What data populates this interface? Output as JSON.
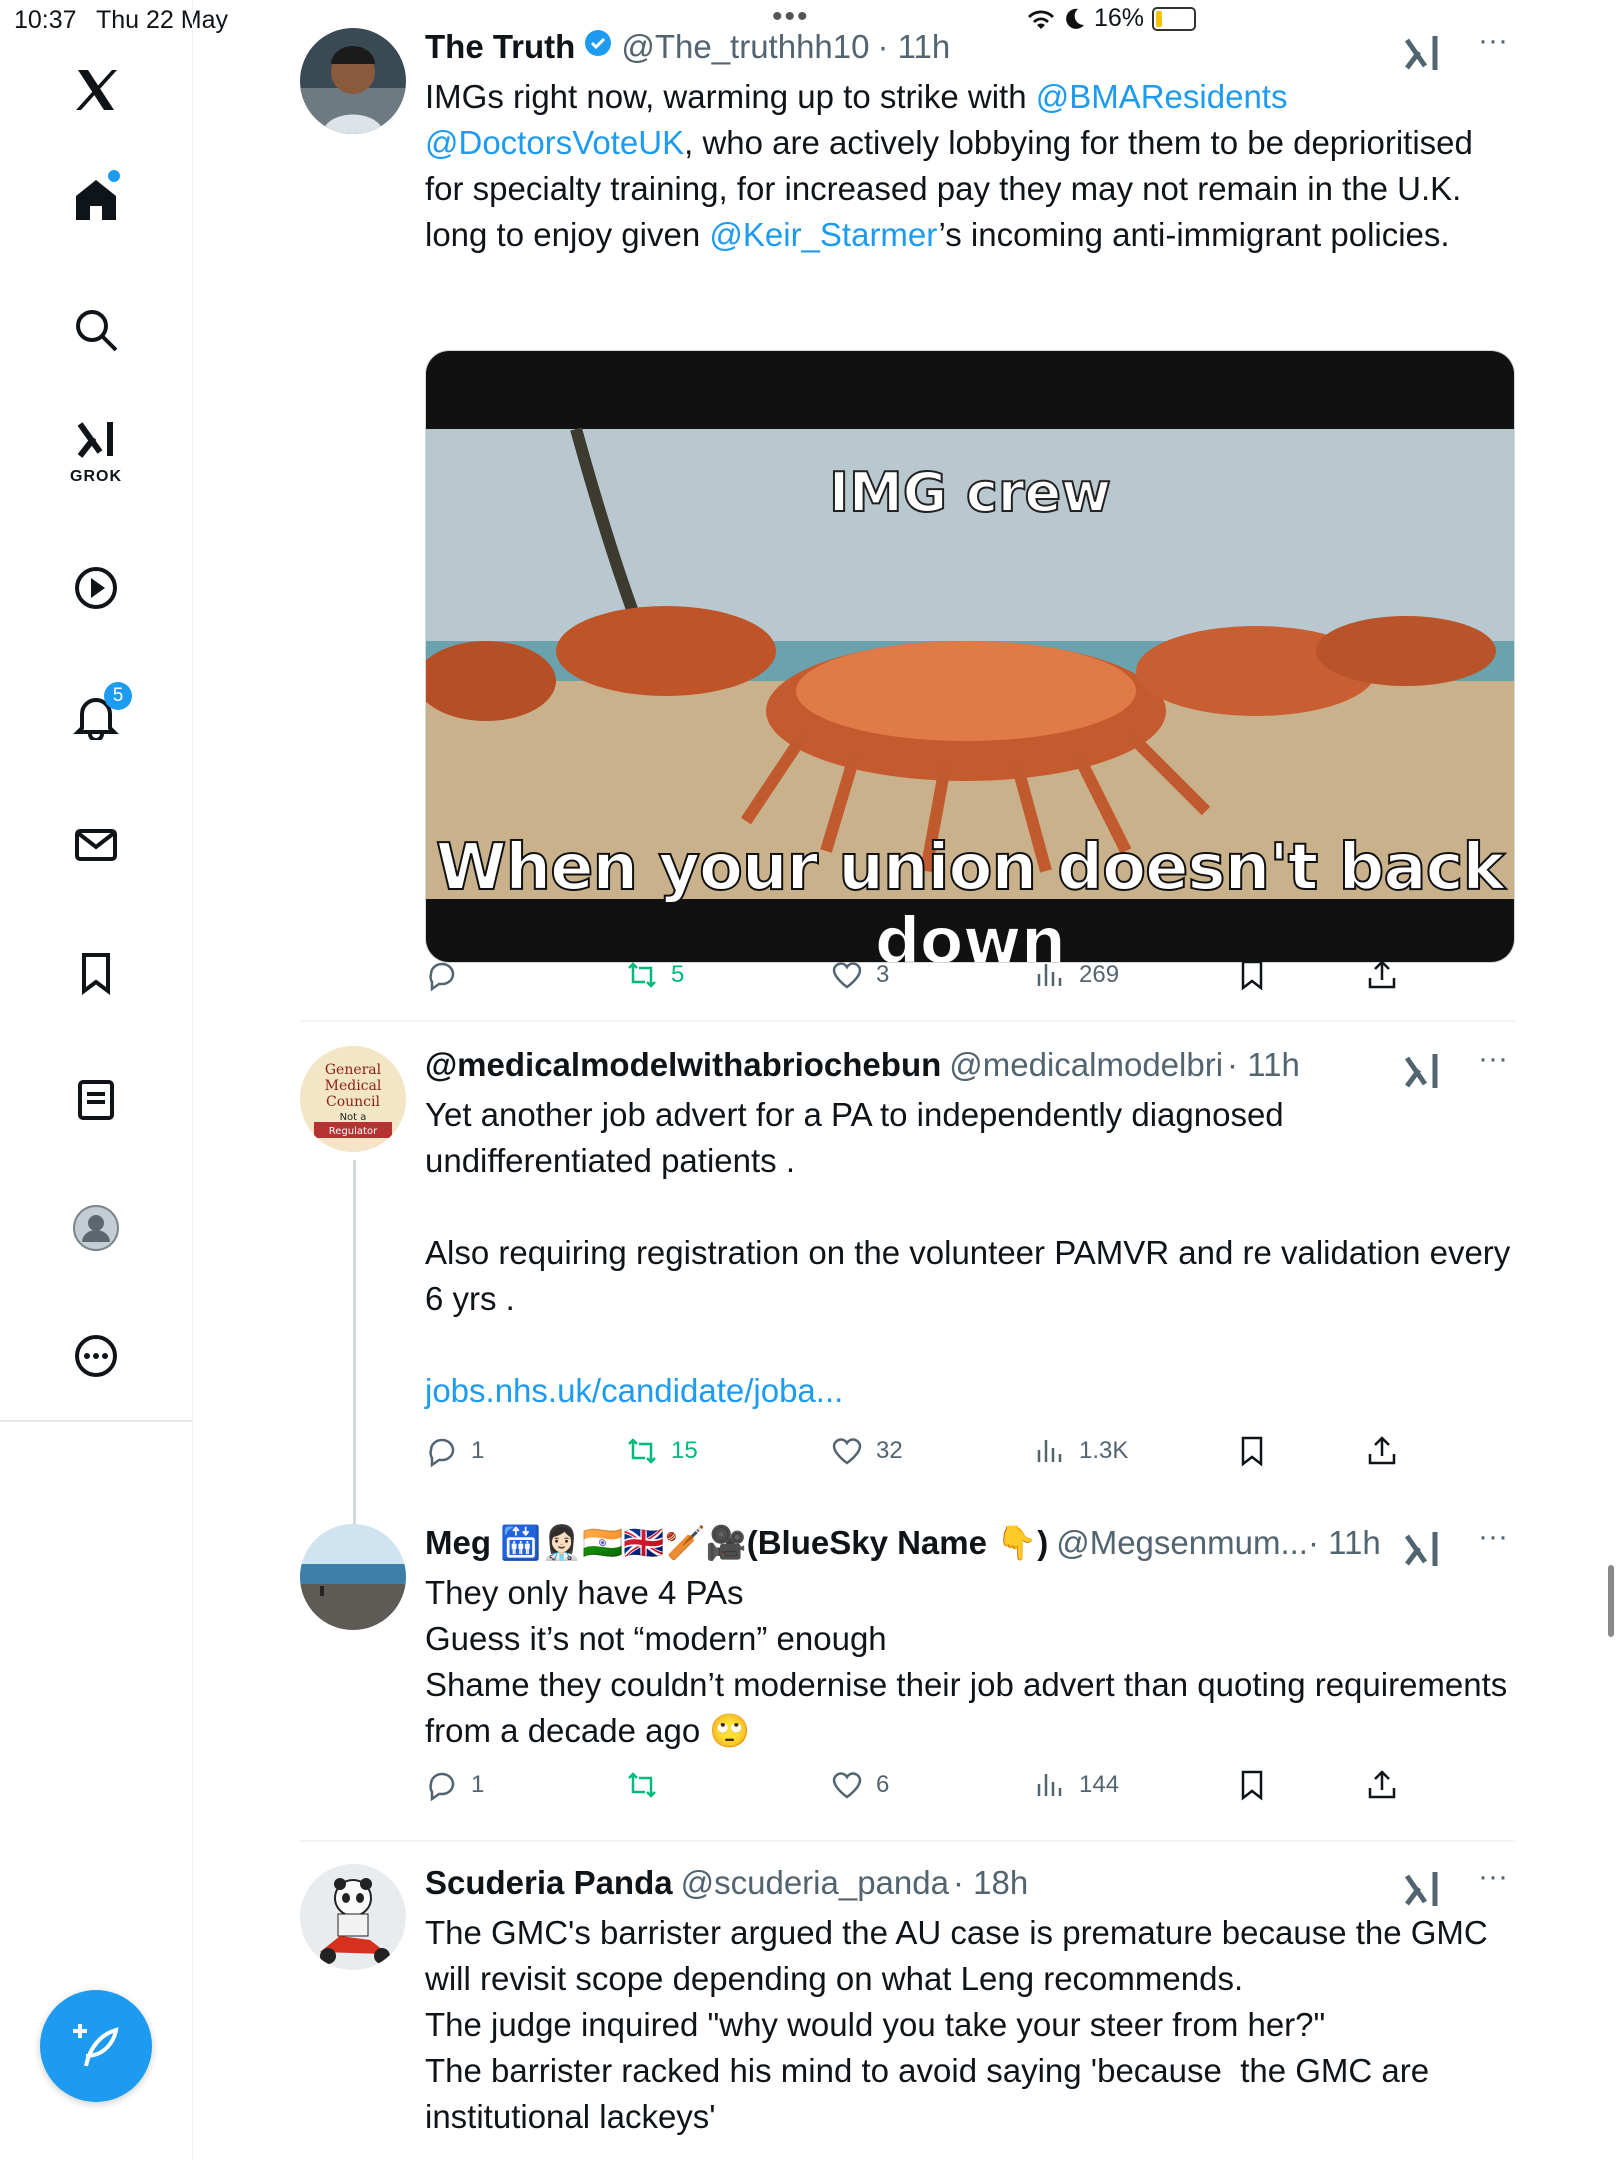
{
  "status_bar": {
    "time": "10:37",
    "date": "Thu 22 May",
    "battery": "16%",
    "battery_level": 0.16
  },
  "sidebar": {
    "notifications_badge": "5",
    "grok_label": "GROK"
  },
  "tweets": [
    {
      "name": "The Truth",
      "handle": "@The_truthhh10",
      "time": "· 11h",
      "text_parts": [
        "IMGs right now, warming up to strike with ",
        "@BMAResidents",
        " ",
        "@DoctorsVoteUK",
        ", who are actively lobbying for them to be deprioritised for specialty training, for increased pay they may not remain in the U.K. long to enjoy given ",
        "@Keir_Starmer",
        "’s incoming anti-immigrant policies."
      ],
      "media_caption_top": "IMG crew",
      "media_caption_bottom": "When your union doesn't back down",
      "replies": "",
      "retweets": "5",
      "likes": "3",
      "views": "269"
    },
    {
      "name": "@medicalmodelwithabriochebun",
      "handle": "@medicalmodelbri",
      "time": "· 11h",
      "text": "Yet another job advert for a PA to independently diagnosed undifferentiated patients .\n\nAlso requiring registration on the volunteer PAMVR and re validation every 6 yrs .\n\n",
      "link": "jobs.nhs.uk/candidate/joba...",
      "avatar_text": [
        "General",
        "Medical",
        "Council",
        "Not a",
        "Regulator"
      ],
      "replies": "1",
      "retweets": "15",
      "likes": "32",
      "views": "1.3K"
    },
    {
      "name": "Meg 🛗👩🏻‍⚕️🇮🇳🇬🇧🏏🎥(BlueSky Name 👇)",
      "handle": "@Megsenmum...",
      "time": "· 11h",
      "text": "They only have 4 PAs\nGuess it’s not “modern” enough\nShame they couldn’t modernise their job advert than quoting requirements from a decade ago 🙄",
      "replies": "1",
      "retweets": "",
      "likes": "6",
      "views": "144"
    },
    {
      "name": "Scuderia Panda",
      "handle": "@scuderia_panda",
      "time": "· 18h",
      "text": "The GMC's barrister argued the AU case is premature because the GMC will revisit scope depending on what Leng recommends.\nThe judge inquired \"why would you take your steer from her?\"\nThe barrister racked his mind to avoid saying 'because  the GMC are institutional lackeys'"
    }
  ]
}
